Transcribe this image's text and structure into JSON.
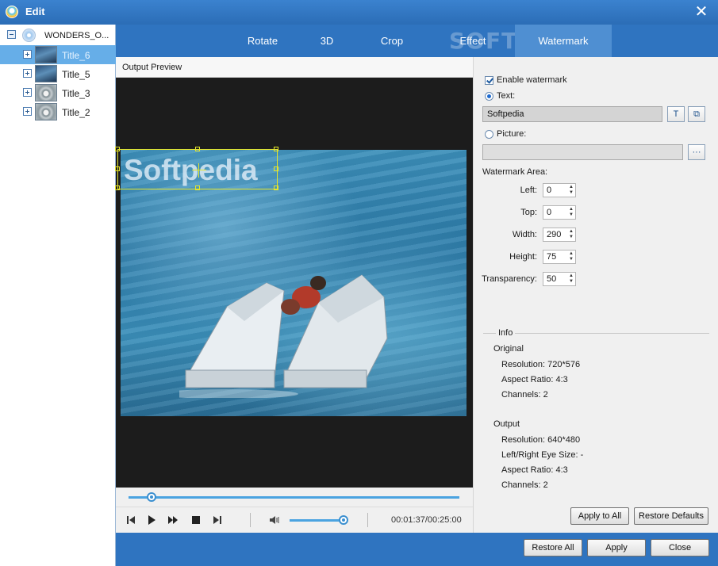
{
  "window": {
    "title": "Edit"
  },
  "sidebar": {
    "root_label": "WONDERS_O...",
    "items": [
      {
        "label": "Title_6",
        "selected": true,
        "thumb": "blue"
      },
      {
        "label": "Title_5",
        "selected": false,
        "thumb": "blue"
      },
      {
        "label": "Title_3",
        "selected": false,
        "thumb": "grey"
      },
      {
        "label": "Title_2",
        "selected": false,
        "thumb": "grey"
      }
    ]
  },
  "tabs": [
    {
      "label": "Rotate"
    },
    {
      "label": "3D"
    },
    {
      "label": "Crop"
    },
    {
      "label": "Effect"
    },
    {
      "label": "Watermark",
      "active": true
    }
  ],
  "brand_watermark": "SOFTPEDIA",
  "preview": {
    "header": "Output Preview",
    "watermark_text": "Softpedia",
    "timecode": "00:01:37/00:25:00",
    "seek_fraction": 0.07,
    "volume_fraction": 0.95
  },
  "watermark": {
    "enable_label": "Enable watermark",
    "enabled": true,
    "text_option_label": "Text:",
    "text_value": "Softpedia",
    "picture_option_label": "Picture:",
    "picture_value": "",
    "browse_label": "···",
    "area_label": "Watermark Area:",
    "fields": [
      {
        "label": "Left:",
        "value": "0"
      },
      {
        "label": "Top:",
        "value": "0"
      },
      {
        "label": "Width:",
        "value": "290"
      },
      {
        "label": "Height:",
        "value": "75"
      },
      {
        "label": "Transparency:",
        "value": "50"
      }
    ]
  },
  "info": {
    "group_title": "Info",
    "original_label": "Original",
    "original": {
      "resolution": "Resolution: 720*576",
      "aspect": "Aspect Ratio: 4:3",
      "channels": "Channels: 2"
    },
    "output_label": "Output",
    "output": {
      "resolution": "Resolution: 640*480",
      "eye_size": "Left/Right Eye Size: -",
      "aspect": "Aspect Ratio: 4:3",
      "channels": "Channels: 2"
    }
  },
  "buttons": {
    "apply_to_all": "Apply to All",
    "restore_defaults": "Restore Defaults",
    "restore_all": "Restore All",
    "apply": "Apply",
    "close": "Close"
  },
  "colors": {
    "accent": "#2f74c0",
    "tab_active": "#4f8fd2",
    "selection": "#66aee8",
    "overlay": "#e5e52a"
  }
}
